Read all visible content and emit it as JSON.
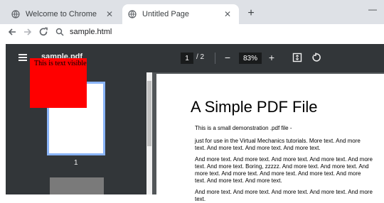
{
  "browser": {
    "tabs": [
      {
        "label": "Welcome to Chrome",
        "active": false
      },
      {
        "label": "Untitled Page",
        "active": true
      }
    ],
    "address": "sample.html"
  },
  "pdf_viewer": {
    "doc_title": "sample.pdf",
    "page_current": "1",
    "page_total": "/ 2",
    "zoom": "83%",
    "thumbnail_page_label": "1",
    "overlay_text": "This is text visible"
  },
  "document": {
    "title": "A Simple PDF File",
    "paragraphs": [
      "This is a small demonstration .pdf file -",
      "just for use in the Virtual Mechanics tutorials. More text. And more text. And more text. And more text. And more text.",
      "And more text. And more text. And more text. And more text. And more text. And more text. Boring, zzzzz. And more text. And more text. And more text. And more text. And more text. And more text. And more text. And more text. And more text.",
      "And more text. And more text. And more text. And more text. And more text."
    ]
  },
  "colors": {
    "overlay_red": "#ff0000",
    "viewer_dark": "#323639",
    "selected_thumb": "#8ab4f8"
  }
}
